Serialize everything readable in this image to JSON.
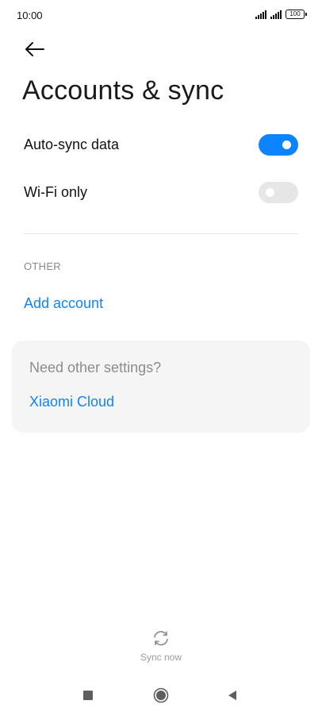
{
  "status_bar": {
    "time": "10:00",
    "battery": "100"
  },
  "header": {
    "back_icon": "arrow-left-icon",
    "title": "Accounts & sync"
  },
  "settings": [
    {
      "label": "Auto-sync data",
      "enabled": true
    },
    {
      "label": "Wi-Fi only",
      "enabled": false
    }
  ],
  "other": {
    "section_label": "OTHER",
    "add_account_label": "Add account"
  },
  "card": {
    "title": "Need other settings?",
    "link_label": "Xiaomi Cloud"
  },
  "footer": {
    "sync_icon": "sync-icon",
    "sync_label": "Sync now"
  },
  "nav": {
    "recent_icon": "square-icon",
    "home_icon": "circle-icon",
    "back_icon": "triangle-back-icon"
  },
  "colors": {
    "accent": "#0d84ff",
    "toggle_off": "#e6e6e6",
    "card_bg": "#f5f5f5"
  }
}
